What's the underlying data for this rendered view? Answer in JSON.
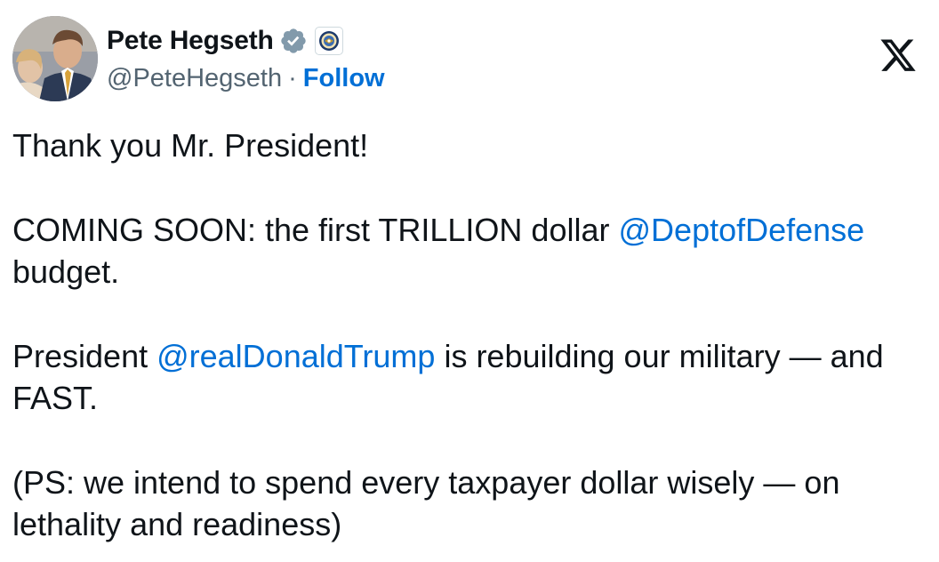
{
  "author": {
    "name": "Pete Hegseth",
    "handle": "@PeteHegseth",
    "separator": "·",
    "follow_label": "Follow"
  },
  "icons": {
    "verified": "verified-badge-icon",
    "affiliation": "defense-seal-icon",
    "platform": "x-logo-icon"
  },
  "colors": {
    "link": "#006fd6",
    "text": "#0f1419",
    "secondary": "#536471",
    "verified_badge": "#829aab"
  },
  "tweet": {
    "line1": "Thank you Mr. President!",
    "p2_text": "COMING SOON: the first TRILLION dollar ",
    "p2_mention": "@DeptofDefense",
    "p2_tail": "budget.",
    "p3_text": "President ",
    "p3_mention": "@realDonaldTrump",
    "p3_tail": " is rebuilding our military — and FAST.",
    "p4": "(PS: we intend to spend every taxpayer dollar wisely — on lethality and readiness)"
  }
}
